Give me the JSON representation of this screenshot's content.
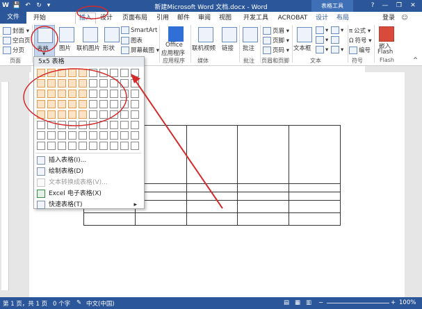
{
  "window": {
    "title": "新建Microsoft Word 文档.docx - Word",
    "context_tab_group": "表格工具",
    "help": "?",
    "minimize": "—",
    "restore": "❐",
    "close": "✕"
  },
  "quick_access": {
    "save": "💾",
    "undo": "↶",
    "redo": "↻",
    "more": "▾"
  },
  "tabs": [
    "文件",
    "开始",
    "插入",
    "设计",
    "页面布局",
    "引用",
    "邮件",
    "审阅",
    "视图",
    "开发工具",
    "ACROBAT",
    "设计",
    "布局"
  ],
  "login": "登录",
  "ribbon": {
    "cover": "封面",
    "blank_page": "空白页",
    "page_break": "分页",
    "table": "表格",
    "picture": "图片",
    "online_picture": "联机图片",
    "shapes": "形状",
    "smartart": "SmartArt",
    "chart": "图表",
    "screenshot": "屏幕截图",
    "office_apps": "Office",
    "office_apps2": "应用程序",
    "online_video": "联机视频",
    "link": "链接",
    "comment": "批注",
    "header": "页眉",
    "footer": "页脚",
    "page_number": "页码",
    "textbox": "文本框",
    "formula": "公式",
    "symbol": "符号",
    "number": "编号",
    "embed_flash": "嵌入",
    "embed_flash2": "Flash",
    "groups": [
      "页面",
      "应用程序",
      "媒体",
      "批注",
      "页眉和页脚",
      "文本",
      "符号",
      "Flash"
    ]
  },
  "dropdown": {
    "header": "5x5 表格",
    "menu": [
      {
        "label": "插入表格(I)...",
        "disabled": false,
        "arrow": ""
      },
      {
        "label": "绘制表格(D)",
        "disabled": false,
        "arrow": ""
      },
      {
        "label": "文本转换成表格(V)...",
        "disabled": true,
        "arrow": ""
      },
      {
        "label": "Excel 电子表格(X)",
        "disabled": false,
        "arrow": ""
      },
      {
        "label": "快速表格(T)",
        "disabled": false,
        "arrow": "▸"
      }
    ]
  },
  "status_bar": {
    "page": "第 1 页，共 1 页",
    "words": "0 个字",
    "language": "中文(中国)",
    "zoom": "100%"
  },
  "colors": {
    "accent": "#2b579a",
    "annotation": "#d32a2a",
    "grid_selected": "#e49b4b"
  }
}
